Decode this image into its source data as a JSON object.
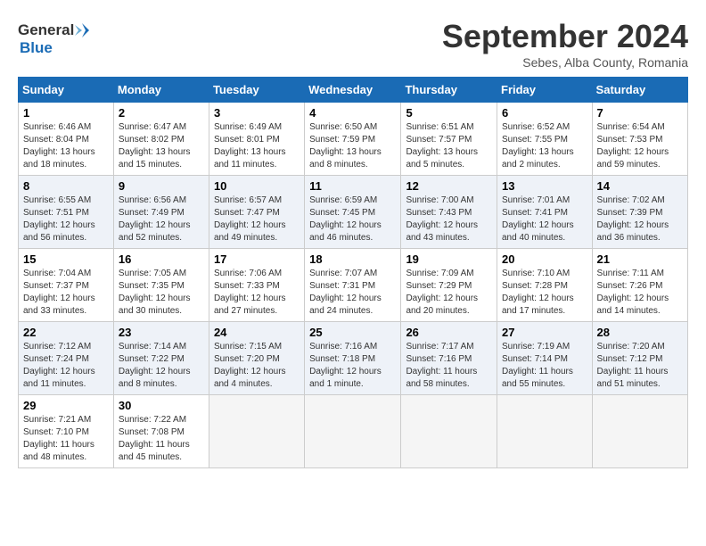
{
  "header": {
    "logo_text_general": "General",
    "logo_text_blue": "Blue",
    "title": "September 2024",
    "subtitle": "Sebes, Alba County, Romania"
  },
  "calendar": {
    "days_of_week": [
      "Sunday",
      "Monday",
      "Tuesday",
      "Wednesday",
      "Thursday",
      "Friday",
      "Saturday"
    ],
    "weeks": [
      [
        null,
        {
          "day": "2",
          "sunrise": "Sunrise: 6:47 AM",
          "sunset": "Sunset: 8:02 PM",
          "daylight": "Daylight: 13 hours and 15 minutes."
        },
        {
          "day": "3",
          "sunrise": "Sunrise: 6:49 AM",
          "sunset": "Sunset: 8:01 PM",
          "daylight": "Daylight: 13 hours and 11 minutes."
        },
        {
          "day": "4",
          "sunrise": "Sunrise: 6:50 AM",
          "sunset": "Sunset: 7:59 PM",
          "daylight": "Daylight: 13 hours and 8 minutes."
        },
        {
          "day": "5",
          "sunrise": "Sunrise: 6:51 AM",
          "sunset": "Sunset: 7:57 PM",
          "daylight": "Daylight: 13 hours and 5 minutes."
        },
        {
          "day": "6",
          "sunrise": "Sunrise: 6:52 AM",
          "sunset": "Sunset: 7:55 PM",
          "daylight": "Daylight: 13 hours and 2 minutes."
        },
        {
          "day": "7",
          "sunrise": "Sunrise: 6:54 AM",
          "sunset": "Sunset: 7:53 PM",
          "daylight": "Daylight: 12 hours and 59 minutes."
        }
      ],
      [
        {
          "day": "1",
          "sunrise": "Sunrise: 6:46 AM",
          "sunset": "Sunset: 8:04 PM",
          "daylight": "Daylight: 13 hours and 18 minutes."
        },
        {
          "day": "9",
          "sunrise": "Sunrise: 6:56 AM",
          "sunset": "Sunset: 7:49 PM",
          "daylight": "Daylight: 12 hours and 52 minutes."
        },
        {
          "day": "10",
          "sunrise": "Sunrise: 6:57 AM",
          "sunset": "Sunset: 7:47 PM",
          "daylight": "Daylight: 12 hours and 49 minutes."
        },
        {
          "day": "11",
          "sunrise": "Sunrise: 6:59 AM",
          "sunset": "Sunset: 7:45 PM",
          "daylight": "Daylight: 12 hours and 46 minutes."
        },
        {
          "day": "12",
          "sunrise": "Sunrise: 7:00 AM",
          "sunset": "Sunset: 7:43 PM",
          "daylight": "Daylight: 12 hours and 43 minutes."
        },
        {
          "day": "13",
          "sunrise": "Sunrise: 7:01 AM",
          "sunset": "Sunset: 7:41 PM",
          "daylight": "Daylight: 12 hours and 40 minutes."
        },
        {
          "day": "14",
          "sunrise": "Sunrise: 7:02 AM",
          "sunset": "Sunset: 7:39 PM",
          "daylight": "Daylight: 12 hours and 36 minutes."
        }
      ],
      [
        {
          "day": "8",
          "sunrise": "Sunrise: 6:55 AM",
          "sunset": "Sunset: 7:51 PM",
          "daylight": "Daylight: 12 hours and 56 minutes."
        },
        {
          "day": "16",
          "sunrise": "Sunrise: 7:05 AM",
          "sunset": "Sunset: 7:35 PM",
          "daylight": "Daylight: 12 hours and 30 minutes."
        },
        {
          "day": "17",
          "sunrise": "Sunrise: 7:06 AM",
          "sunset": "Sunset: 7:33 PM",
          "daylight": "Daylight: 12 hours and 27 minutes."
        },
        {
          "day": "18",
          "sunrise": "Sunrise: 7:07 AM",
          "sunset": "Sunset: 7:31 PM",
          "daylight": "Daylight: 12 hours and 24 minutes."
        },
        {
          "day": "19",
          "sunrise": "Sunrise: 7:09 AM",
          "sunset": "Sunset: 7:29 PM",
          "daylight": "Daylight: 12 hours and 20 minutes."
        },
        {
          "day": "20",
          "sunrise": "Sunrise: 7:10 AM",
          "sunset": "Sunset: 7:28 PM",
          "daylight": "Daylight: 12 hours and 17 minutes."
        },
        {
          "day": "21",
          "sunrise": "Sunrise: 7:11 AM",
          "sunset": "Sunset: 7:26 PM",
          "daylight": "Daylight: 12 hours and 14 minutes."
        }
      ],
      [
        {
          "day": "15",
          "sunrise": "Sunrise: 7:04 AM",
          "sunset": "Sunset: 7:37 PM",
          "daylight": "Daylight: 12 hours and 33 minutes."
        },
        {
          "day": "23",
          "sunrise": "Sunrise: 7:14 AM",
          "sunset": "Sunset: 7:22 PM",
          "daylight": "Daylight: 12 hours and 8 minutes."
        },
        {
          "day": "24",
          "sunrise": "Sunrise: 7:15 AM",
          "sunset": "Sunset: 7:20 PM",
          "daylight": "Daylight: 12 hours and 4 minutes."
        },
        {
          "day": "25",
          "sunrise": "Sunrise: 7:16 AM",
          "sunset": "Sunset: 7:18 PM",
          "daylight": "Daylight: 12 hours and 1 minute."
        },
        {
          "day": "26",
          "sunrise": "Sunrise: 7:17 AM",
          "sunset": "Sunset: 7:16 PM",
          "daylight": "Daylight: 11 hours and 58 minutes."
        },
        {
          "day": "27",
          "sunrise": "Sunrise: 7:19 AM",
          "sunset": "Sunset: 7:14 PM",
          "daylight": "Daylight: 11 hours and 55 minutes."
        },
        {
          "day": "28",
          "sunrise": "Sunrise: 7:20 AM",
          "sunset": "Sunset: 7:12 PM",
          "daylight": "Daylight: 11 hours and 51 minutes."
        }
      ],
      [
        {
          "day": "22",
          "sunrise": "Sunrise: 7:12 AM",
          "sunset": "Sunset: 7:24 PM",
          "daylight": "Daylight: 12 hours and 11 minutes."
        },
        {
          "day": "30",
          "sunrise": "Sunrise: 7:22 AM",
          "sunset": "Sunset: 7:08 PM",
          "daylight": "Daylight: 11 hours and 45 minutes."
        },
        null,
        null,
        null,
        null,
        null
      ],
      [
        {
          "day": "29",
          "sunrise": "Sunrise: 7:21 AM",
          "sunset": "Sunset: 7:10 PM",
          "daylight": "Daylight: 11 hours and 48 minutes."
        },
        null,
        null,
        null,
        null,
        null,
        null
      ]
    ]
  }
}
